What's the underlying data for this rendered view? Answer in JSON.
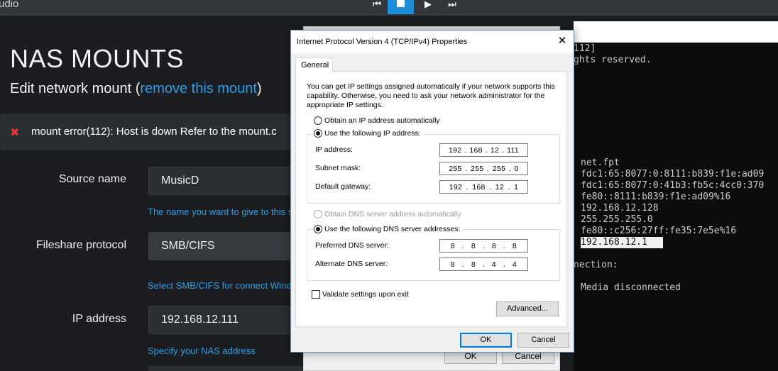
{
  "app": {
    "title": "udio",
    "transport": {
      "prev_icon": "skip-back-icon",
      "stop_icon": "stop-icon",
      "play_icon": "play-icon",
      "next_icon": "skip-forward-icon",
      "accent": "#1e8fd6"
    },
    "page_title": "NAS MOUNTS",
    "subtitle_prefix": "Edit network mount (",
    "subtitle_link": "remove this mount",
    "subtitle_suffix": ")",
    "error": {
      "icon": "error-x-icon",
      "text": "mount error(112): Host is down Refer to the mount.c",
      "color": "#e5392f"
    },
    "form": {
      "source_name": {
        "label": "Source name",
        "value": "MusicD",
        "help": "The name you want to give to this so"
      },
      "protocol": {
        "label": "Fileshare protocol",
        "value": "SMB/CIFS",
        "help": "Select SMB/CIFS for connect Windo"
      },
      "ip_address": {
        "label": "IP address",
        "value": "192.168.12.111",
        "help": "Specify your NAS address"
      }
    }
  },
  "console": {
    "lines": [
      "112]",
      "ghts reserved.",
      "net.fpt",
      "fdc1:65:8077:0:8111:b839:f1e:ad09",
      "fdc1:65:8077:0:41b3:fb5c:4cc0:370",
      "fe80::8111:b839:f1e:ad09%16",
      "192.168.12.128",
      "255.255.255.0",
      "fe80::c256:27ff:fe35:7e5e%16",
      "192.168.12.1",
      "nection:",
      "Media disconnected"
    ]
  },
  "behind_window": {
    "ok_label": "OK",
    "cancel_label": "Cancel"
  },
  "dialog": {
    "title": "Internet Protocol Version 4 (TCP/IPv4) Properties",
    "close_glyph": "✕",
    "tab": "General",
    "intro": "You can get IP settings assigned automatically if your network supports this capability. Otherwise, you need to ask your network administrator for the appropriate IP settings.",
    "ip_auto_label": "Obtain an IP address automatically",
    "ip_manual_label": "Use the following IP address:",
    "ip_mode": "manual",
    "ip_fields": [
      {
        "label": "IP address:",
        "octets": [
          "192",
          "168",
          "12",
          "111"
        ]
      },
      {
        "label": "Subnet mask:",
        "octets": [
          "255",
          "255",
          "255",
          "0"
        ]
      },
      {
        "label": "Default gateway:",
        "octets": [
          "192",
          "168",
          "12",
          "1"
        ]
      }
    ],
    "dns_auto_label": "Obtain DNS server address automatically",
    "dns_manual_label": "Use the following DNS server addresses:",
    "dns_mode": "manual",
    "dns_fields": [
      {
        "label": "Preferred DNS server:",
        "octets": [
          "8",
          "8",
          "8",
          "8"
        ]
      },
      {
        "label": "Alternate DNS server:",
        "octets": [
          "8",
          "8",
          "4",
          "4"
        ]
      }
    ],
    "validate_label": "Validate settings upon exit",
    "validate_checked": false,
    "advanced_label": "Advanced...",
    "ok_label": "OK",
    "cancel_label": "Cancel"
  }
}
